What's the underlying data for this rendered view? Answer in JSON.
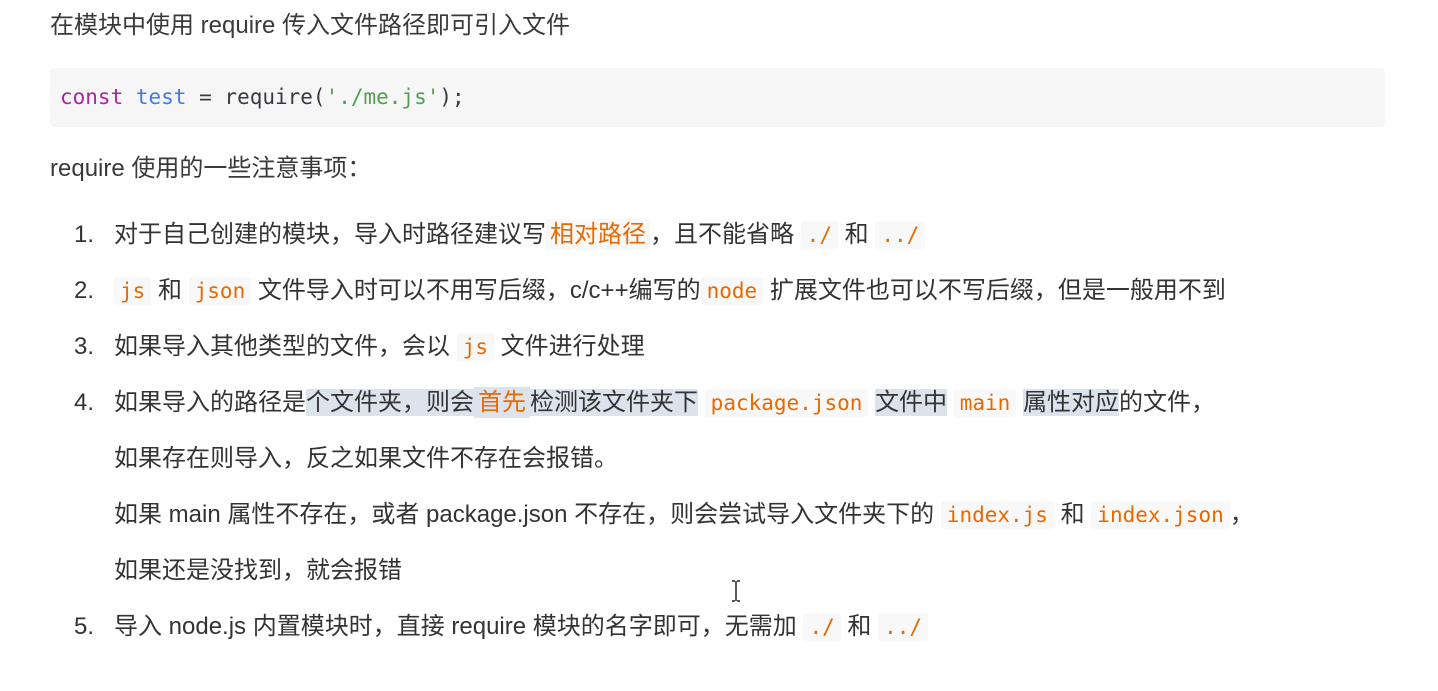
{
  "intro": "在模块中使用 require 传入文件路径即可引入文件",
  "code": {
    "kw": "const",
    "var": "test",
    "op": "=",
    "fn": "require(",
    "str": "'./me.js'",
    "end": ");"
  },
  "notes_title": "require 使用的一些注意事项：",
  "items": [
    {
      "num": "1.",
      "t1": "对于自己创建的模块，导入时路径建议写",
      "hl1": "相对路径",
      "t2": "，且不能省略",
      "c1": "./",
      "t3": "和",
      "c2": "../"
    },
    {
      "num": "2.",
      "c1": "js",
      "t1": "和",
      "c2": "json",
      "t2": "文件导入时可以不用写后缀，c/c++编写的",
      "c3": "node",
      "t3": "扩展文件也可以不写后缀，但是一般用不到"
    },
    {
      "num": "3.",
      "t1": "如果导入其他类型的文件，会以",
      "c1": "js",
      "t2": "文件进行处理"
    },
    {
      "num": "4.",
      "t1": "如果导入的路径是",
      "t1b": "个文件夹，则会",
      "hl1": "首先",
      "t2": "检测该文件夹下",
      "c1": "package.json",
      "t3": "文件中",
      "c2": "main",
      "t4": "属性对应",
      "t4b": "的文件，",
      "line2": "如果存在则导入，反之如果文件不存在会报错。",
      "line3a": "如果 main 属性不存在，或者 package.json 不存在，则会尝试导入文件夹下的",
      "line3c1": "index.js",
      "line3b": "和",
      "line3c2": "index.json",
      "line3end": "，",
      "line4": "如果还是没找到，就会报错"
    },
    {
      "num": "5.",
      "t1": "导入 node.js 内置模块时，直接 require 模块的名字即可，无需加",
      "c1": "./",
      "t2": "和",
      "c2": "../"
    }
  ]
}
